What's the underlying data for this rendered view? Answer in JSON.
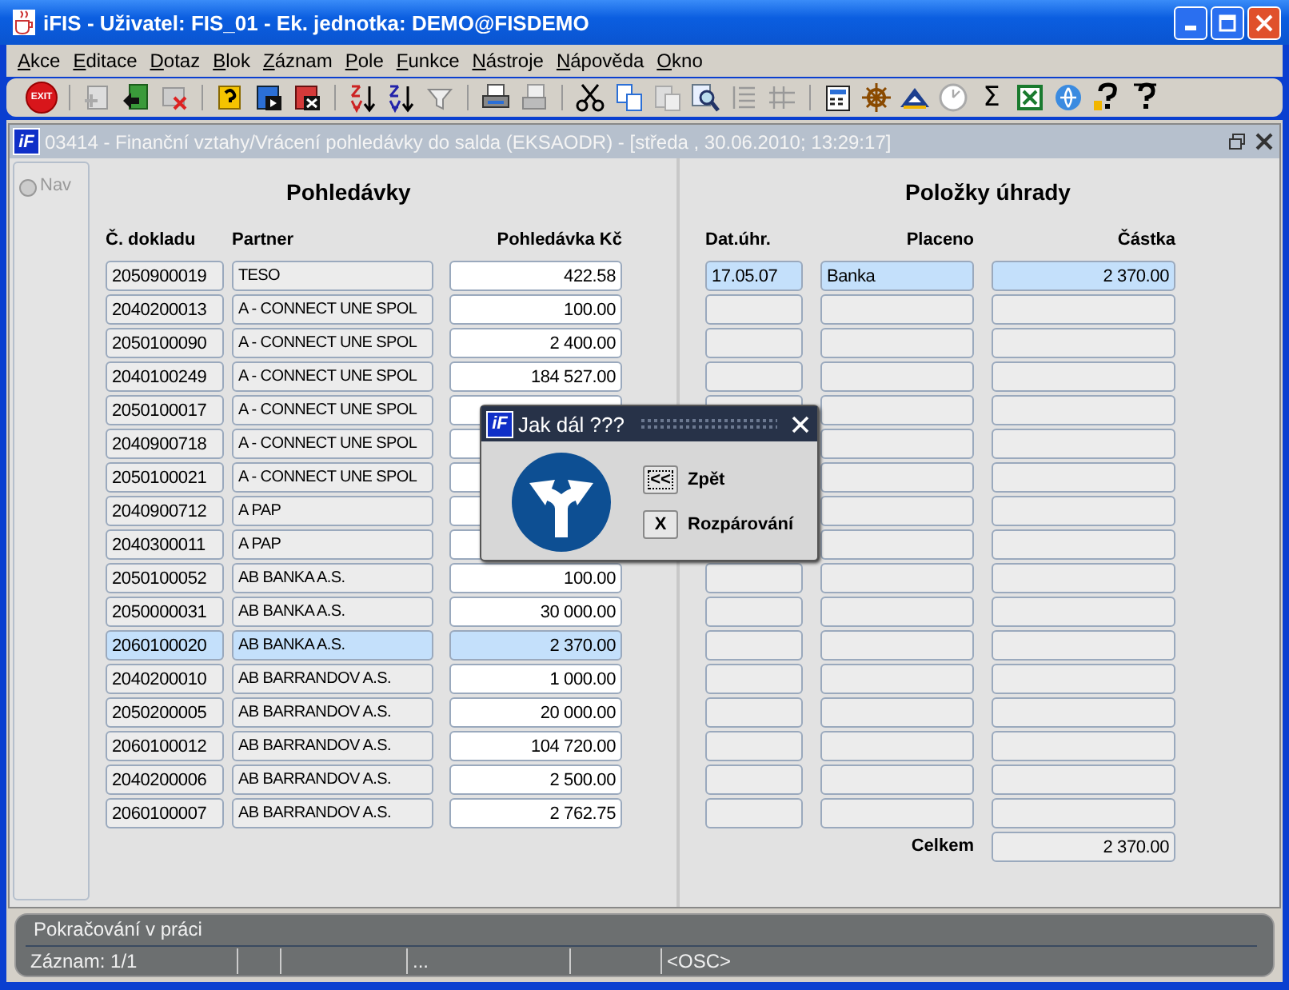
{
  "window": {
    "title": "iFIS - Uživatel: FIS_01 - Ek. jednotka: DEMO@FISDEMO"
  },
  "menu": [
    "Akce",
    "Editace",
    "Dotaz",
    "Blok",
    "Záznam",
    "Pole",
    "Funkce",
    "Nástroje",
    "Nápověda",
    "Okno"
  ],
  "toolbar": {
    "exit_label": "EXIT",
    "sum_glyph": "Σ"
  },
  "form": {
    "logo": "iF",
    "title": "03414 - Finanční vztahy/Vrácení pohledávky do salda (EKSAODR) - [středa , 30.06.2010; 13:29:17]",
    "nav": {
      "label": "Nav",
      "selected": false
    }
  },
  "receivables": {
    "title": "Pohledávky",
    "columns": [
      "Č. dokladu",
      "Partner",
      "Pohledávka Kč"
    ],
    "rows": [
      {
        "doc": "2050900019",
        "partner": "TESO",
        "amount": "422.58",
        "selected": false
      },
      {
        "doc": "2040200013",
        "partner": "A - CONNECT UNE SPOL",
        "amount": "100.00",
        "selected": false
      },
      {
        "doc": "2050100090",
        "partner": "A - CONNECT UNE SPOL",
        "amount": "2 400.00",
        "selected": false
      },
      {
        "doc": "2040100249",
        "partner": "A - CONNECT UNE SPOL",
        "amount": "184 527.00",
        "selected": false
      },
      {
        "doc": "2050100017",
        "partner": "A - CONNECT UNE SPOL",
        "selected": false
      },
      {
        "doc": "2040900718",
        "partner": "A - CONNECT UNE SPOL",
        "selected": false
      },
      {
        "doc": "2050100021",
        "partner": "A - CONNECT UNE SPOL",
        "selected": false
      },
      {
        "doc": "2040900712",
        "partner": "A PAP",
        "selected": false
      },
      {
        "doc": "2040300011",
        "partner": "A PAP",
        "selected": false
      },
      {
        "doc": "2050100052",
        "partner": "AB BANKA A.S.",
        "amount": "100.00",
        "selected": false
      },
      {
        "doc": "2050000031",
        "partner": "AB BANKA A.S.",
        "amount": "30 000.00",
        "selected": false
      },
      {
        "doc": "2060100020",
        "partner": "AB BANKA A.S.",
        "amount": "2 370.00",
        "selected": true
      },
      {
        "doc": "2040200010",
        "partner": "AB BARRANDOV A.S.",
        "amount": "1 000.00",
        "selected": false
      },
      {
        "doc": "2050200005",
        "partner": "AB BARRANDOV A.S.",
        "amount": "20 000.00",
        "selected": false
      },
      {
        "doc": "2060100012",
        "partner": "AB BARRANDOV A.S.",
        "amount": "104 720.00",
        "selected": false
      },
      {
        "doc": "2040200006",
        "partner": "AB BARRANDOV A.S.",
        "amount": "2 500.00",
        "selected": false
      },
      {
        "doc": "2060100007",
        "partner": "AB BARRANDOV A.S.",
        "amount": "2 762.75",
        "selected": false
      }
    ]
  },
  "payments": {
    "title": "Položky úhrady",
    "columns": [
      "Dat.úhr.",
      "Placeno",
      "Částka"
    ],
    "rows": [
      {
        "date": "17.05.07",
        "paid": "Banka",
        "amount": "2 370.00",
        "selected": true
      },
      {
        "selected": false
      },
      {
        "selected": false
      },
      {
        "selected": false
      },
      {
        "selected": false
      },
      {
        "selected": false
      },
      {
        "selected": false
      },
      {
        "selected": false
      },
      {
        "selected": false
      },
      {
        "selected": false
      },
      {
        "selected": false
      },
      {
        "selected": false
      },
      {
        "selected": false
      },
      {
        "selected": false
      },
      {
        "selected": false
      },
      {
        "selected": false
      },
      {
        "selected": false
      }
    ],
    "total_label": "Celkem",
    "total": "2 370.00"
  },
  "dialog": {
    "logo": "iF",
    "title": "Jak dál ???",
    "buttons": [
      {
        "key": "<<",
        "label": "Zpět",
        "focused": true
      },
      {
        "key": "X",
        "label": "Rozpárování",
        "focused": false
      }
    ]
  },
  "status": {
    "message": "Pokračování v práci",
    "record": "Záznam: 1/1",
    "cells": [
      "",
      "",
      "...",
      "",
      "<OSC>"
    ]
  }
}
